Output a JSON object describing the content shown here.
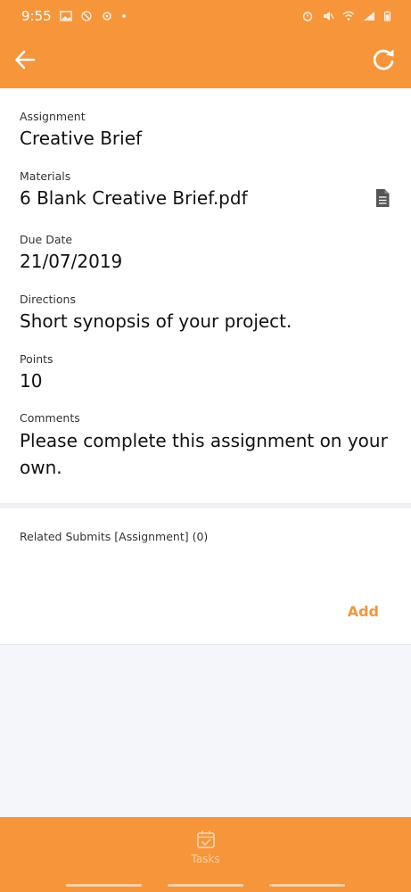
{
  "status_bar": {
    "time": "9:55",
    "icons_left": [
      "gallery-icon",
      "mute-icon",
      "gear-icon",
      "dot-icon"
    ],
    "icons_right": [
      "alarm-icon",
      "silent-icon",
      "wifi-icon",
      "signal-icon",
      "battery-icon"
    ]
  },
  "toolbar": {
    "back_icon": "arrow-left-icon",
    "refresh_icon": "refresh-icon"
  },
  "details": {
    "assignment_label": "Assignment",
    "assignment_value": "Creative Brief",
    "materials_label": "Materials",
    "materials_value": "6 Blank Creative Brief.pdf",
    "due_label": "Due Date",
    "due_value": "21/07/2019",
    "directions_label": "Directions",
    "directions_value": "Short synopsis of your project.",
    "points_label": "Points",
    "points_value": "10",
    "comments_label": "Comments",
    "comments_value": "Please complete this assignment on your own."
  },
  "submits": {
    "label": "Related Submits [Assignment] (0)",
    "add_label": "Add"
  },
  "bottom_nav": {
    "tasks_label": "Tasks",
    "tasks_icon": "calendar-check-icon"
  },
  "colors": {
    "accent": "#f6953a",
    "surface": "#ffffff",
    "background": "#f5f6f9"
  }
}
